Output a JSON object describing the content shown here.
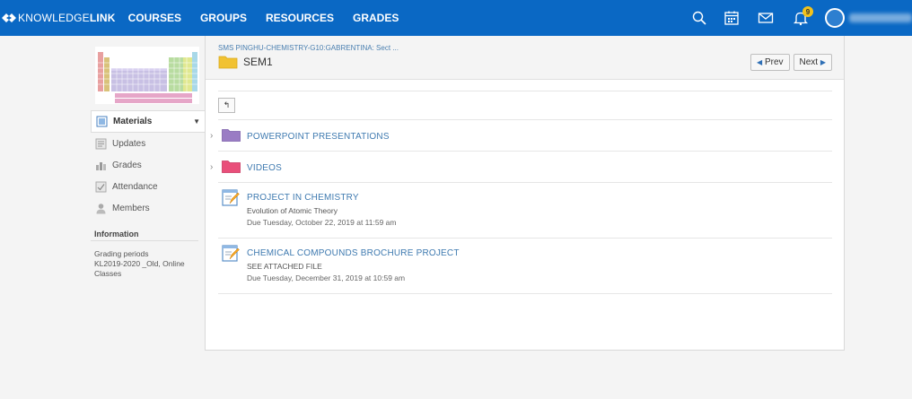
{
  "brand": {
    "name_light": "KNOWLEDGE",
    "name_bold": "LINK"
  },
  "nav": {
    "courses": "COURSES",
    "groups": "GROUPS",
    "resources": "RESOURCES",
    "grades": "GRADES"
  },
  "topbar_icons": [
    "search-icon",
    "calendar-icon",
    "mail-icon",
    "bell-icon"
  ],
  "notifications": {
    "count": "9"
  },
  "colors": {
    "topbar": "#0a68c4",
    "link": "#3f7ab0",
    "badge": "#f2c21b",
    "purple_folder": "#9a7cc4",
    "pink_folder": "#e94f7a",
    "yellow_folder": "#f1c232"
  },
  "sidebar": {
    "items": [
      {
        "label": "Materials",
        "icon": "materials-icon",
        "active": true
      },
      {
        "label": "Updates",
        "icon": "updates-icon"
      },
      {
        "label": "Grades",
        "icon": "grades-icon"
      },
      {
        "label": "Attendance",
        "icon": "attendance-icon"
      },
      {
        "label": "Members",
        "icon": "members-icon"
      }
    ],
    "info_title": "Information",
    "grading_label": "Grading periods",
    "grading_value": "KL2019-2020 _Old, Online Classes"
  },
  "main": {
    "breadcrumb": "SMS PINGHU-CHEMISTRY-G10:GABRENTINA: Sect ...",
    "folder_title": "SEM1",
    "prev_label": "Prev",
    "next_label": "Next",
    "items": [
      {
        "type": "folder",
        "title": "POWERPOINT PRESENTATIONS",
        "color": "purple"
      },
      {
        "type": "folder",
        "title": "VIDEOS",
        "color": "pink"
      },
      {
        "type": "assignment",
        "title": "PROJECT IN CHEMISTRY",
        "subtitle": "Evolution of Atomic Theory",
        "due": "Due Tuesday, October 22, 2019 at 11:59 am"
      },
      {
        "type": "assignment",
        "title": "CHEMICAL COMPOUNDS BROCHURE PROJECT",
        "subtitle": "SEE ATTACHED FILE",
        "due": "Due Tuesday, December 31, 2019 at 10:59 am"
      }
    ]
  }
}
